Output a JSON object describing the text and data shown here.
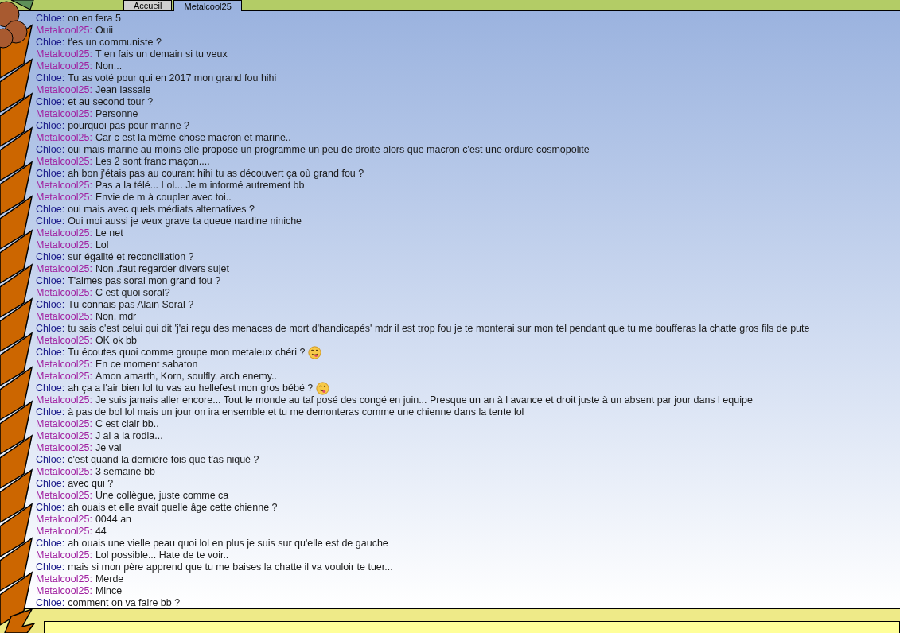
{
  "tabs": [
    {
      "label": "Accueil",
      "selected": false
    },
    {
      "label": "Metalcool25",
      "selected": true
    }
  ],
  "messages": [
    {
      "author": "Chloe:",
      "color": "#1c1c8a",
      "text": "on en fera 5",
      "emoji": false
    },
    {
      "author": "Metalcool25:",
      "color": "#a020a0",
      "text": "Ouii",
      "emoji": false
    },
    {
      "author": "Chloe:",
      "color": "#1c1c8a",
      "text": "t'es un communiste ?",
      "emoji": false
    },
    {
      "author": "Metalcool25:",
      "color": "#a020a0",
      "text": "T en fais un demain si tu veux",
      "emoji": false
    },
    {
      "author": "Metalcool25:",
      "color": "#a020a0",
      "text": "Non...",
      "emoji": false
    },
    {
      "author": "Chloe:",
      "color": "#1c1c8a",
      "text": "Tu as voté pour qui en 2017 mon grand fou hihi",
      "emoji": false
    },
    {
      "author": "Metalcool25:",
      "color": "#a020a0",
      "text": "Jean lassale",
      "emoji": false
    },
    {
      "author": "Chloe:",
      "color": "#1c1c8a",
      "text": "et au second tour ?",
      "emoji": false
    },
    {
      "author": "Metalcool25:",
      "color": "#a020a0",
      "text": "Personne",
      "emoji": false
    },
    {
      "author": "Chloe:",
      "color": "#1c1c8a",
      "text": "pourquoi pas pour marine ?",
      "emoji": false
    },
    {
      "author": "Metalcool25:",
      "color": "#a020a0",
      "text": "Car c est la même chose macron et marine..",
      "emoji": false
    },
    {
      "author": "Chloe:",
      "color": "#1c1c8a",
      "text": "oui mais marine au moins elle propose un programme un peu de droite alors que macron c'est une ordure cosmopolite",
      "emoji": false
    },
    {
      "author": "Metalcool25:",
      "color": "#a020a0",
      "text": "Les 2 sont franc maçon....",
      "emoji": false
    },
    {
      "author": "Chloe:",
      "color": "#1c1c8a",
      "text": "ah bon j'étais pas au courant hihi tu as découvert ça où grand fou ?",
      "emoji": false
    },
    {
      "author": "Metalcool25:",
      "color": "#a020a0",
      "text": "Pas a la télé... Lol... Je m informé autrement bb",
      "emoji": false
    },
    {
      "author": "Metalcool25:",
      "color": "#a020a0",
      "text": "Envie de m à coupler avec toi..",
      "emoji": false
    },
    {
      "author": "Chloe:",
      "color": "#1c1c8a",
      "text": "oui mais avec quels médiats alternatives ?",
      "emoji": false
    },
    {
      "author": "Chloe:",
      "color": "#1c1c8a",
      "text": "Oui moi aussi je veux grave ta queue nardine niniche",
      "emoji": false
    },
    {
      "author": "Metalcool25:",
      "color": "#a020a0",
      "text": "Le net",
      "emoji": false
    },
    {
      "author": "Metalcool25:",
      "color": "#a020a0",
      "text": "Lol",
      "emoji": false
    },
    {
      "author": "Chloe:",
      "color": "#1c1c8a",
      "text": "sur égalité et reconciliation ?",
      "emoji": false
    },
    {
      "author": "Metalcool25:",
      "color": "#a020a0",
      "text": "Non..faut regarder divers sujet",
      "emoji": false
    },
    {
      "author": "Chloe:",
      "color": "#1c1c8a",
      "text": "T'aimes pas soral mon grand fou ?",
      "emoji": false
    },
    {
      "author": "Metalcool25:",
      "color": "#a020a0",
      "text": "C est quoi soral?",
      "emoji": false
    },
    {
      "author": "Chloe:",
      "color": "#1c1c8a",
      "text": "Tu connais pas Alain Soral ?",
      "emoji": false
    },
    {
      "author": "Metalcool25:",
      "color": "#a020a0",
      "text": "Non, mdr",
      "emoji": false
    },
    {
      "author": "Chloe:",
      "color": "#1c1c8a",
      "text": "tu sais c'est celui qui dit 'j'ai reçu des menaces de mort d'handicapés' mdr il est trop fou je te monterai sur mon tel pendant que tu me boufferas la chatte gros fils de pute",
      "emoji": false
    },
    {
      "author": "Metalcool25:",
      "color": "#a020a0",
      "text": "OK ok bb",
      "emoji": false
    },
    {
      "author": "Chloe:",
      "color": "#1c1c8a",
      "text": "Tu écoutes quoi comme groupe mon metaleux chéri ?",
      "emoji": true
    },
    {
      "author": "Metalcool25:",
      "color": "#a020a0",
      "text": "En ce moment sabaton",
      "emoji": false
    },
    {
      "author": "Metalcool25:",
      "color": "#a020a0",
      "text": "Amon amarth, Korn, soulfly, arch enemy..",
      "emoji": false
    },
    {
      "author": "Chloe:",
      "color": "#1c1c8a",
      "text": "ah ça a l'air bien lol tu vas au hellefest mon gros bébé ?",
      "emoji": true
    },
    {
      "author": "Metalcool25:",
      "color": "#a020a0",
      "text": "Je suis jamais aller encore... Tout le monde au taf posé des congé en juin... Presque un an à l avance et droit juste à un absent par jour dans l equipe",
      "emoji": false
    },
    {
      "author": "Chloe:",
      "color": "#1c1c8a",
      "text": "à pas de bol lol mais un jour on ira ensemble et tu me demonteras comme une chienne dans la tente lol",
      "emoji": false
    },
    {
      "author": "Metalcool25:",
      "color": "#a020a0",
      "text": "C est clair bb..",
      "emoji": false
    },
    {
      "author": "Metalcool25:",
      "color": "#a020a0",
      "text": "J ai a la rodia...",
      "emoji": false
    },
    {
      "author": "Metalcool25:",
      "color": "#a020a0",
      "text": "Je vai",
      "emoji": false
    },
    {
      "author": "Chloe:",
      "color": "#1c1c8a",
      "text": "c'est quand la dernière fois que t'as niqué ?",
      "emoji": false
    },
    {
      "author": "Metalcool25:",
      "color": "#a020a0",
      "text": "3 semaine bb",
      "emoji": false
    },
    {
      "author": "Chloe:",
      "color": "#1c1c8a",
      "text": "avec qui ?",
      "emoji": false
    },
    {
      "author": "Metalcool25:",
      "color": "#a020a0",
      "text": "Une collègue, juste comme ca",
      "emoji": false
    },
    {
      "author": "Chloe:",
      "color": "#1c1c8a",
      "text": "ah ouais et elle avait quelle âge cette chienne ?",
      "emoji": false
    },
    {
      "author": "Metalcool25:",
      "color": "#a020a0",
      "text": "0044 an",
      "emoji": false
    },
    {
      "author": "Metalcool25:",
      "color": "#a020a0",
      "text": "44",
      "emoji": false
    },
    {
      "author": "Chloe:",
      "color": "#1c1c8a",
      "text": "ah ouais une vielle peau quoi lol en plus je suis sur qu'elle est de gauche",
      "emoji": false
    },
    {
      "author": "Metalcool25:",
      "color": "#a020a0",
      "text": "Lol possible... Hate de te voir..",
      "emoji": false
    },
    {
      "author": "Chloe:",
      "color": "#1c1c8a",
      "text": "mais si mon père apprend que tu me baises la chatte il va vouloir te tuer...",
      "emoji": false
    },
    {
      "author": "Metalcool25:",
      "color": "#a020a0",
      "text": "Merde",
      "emoji": false
    },
    {
      "author": "Metalcool25:",
      "color": "#a020a0",
      "text": "Mince",
      "emoji": false
    },
    {
      "author": "Chloe:",
      "color": "#1c1c8a",
      "text": "comment on va faire bb ?",
      "emoji": false
    }
  ]
}
